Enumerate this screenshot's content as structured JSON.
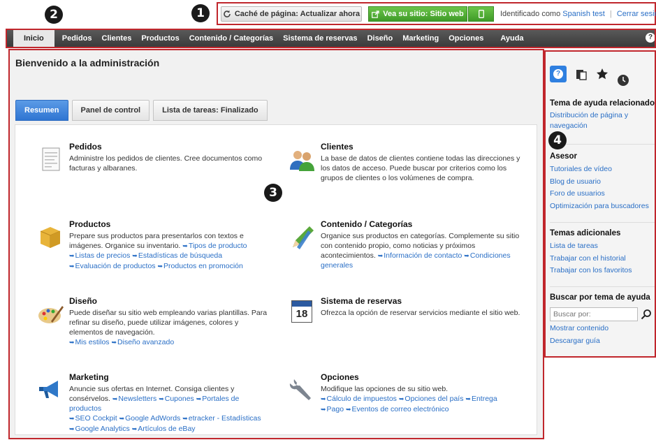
{
  "topbar": {
    "badge1": "1",
    "badge2": "2",
    "cache_button": "Caché de página: Actualizar ahora",
    "view_site_button": "Vea su sitio: Sitio web",
    "identified_label": "Identificado como",
    "user_name": "Spanish test",
    "logout": "Cerrar sesión"
  },
  "nav": {
    "items": [
      "Inicio",
      "Pedidos",
      "Clientes",
      "Productos",
      "Contenido / Categorías",
      "Sistema de reservas",
      "Diseño",
      "Marketing",
      "Opciones",
      "Ayuda"
    ],
    "help_glyph": "?"
  },
  "main": {
    "title": "Bienvenido a la administración",
    "badge3": "3",
    "tabs": [
      "Resumen",
      "Panel de control",
      "Lista de tareas: Finalizado"
    ],
    "cards": {
      "pedidos": {
        "title": "Pedidos",
        "desc": "Administre los pedidos de clientes. Cree documentos como facturas y albaranes."
      },
      "clientes": {
        "title": "Clientes",
        "desc": "La base de datos de clientes contiene todas las direcciones y los datos de acceso. Puede buscar por criterios como los grupos de clientes o los volúmenes de compra."
      },
      "productos": {
        "title": "Productos",
        "desc": "Prepare sus productos para presentarlos con textos e imágenes. Organice su inventario.",
        "links": [
          "Tipos de producto",
          "Listas de precios",
          "Estadísticas de búsqueda",
          "Evaluación de productos",
          "Productos en promoción"
        ]
      },
      "contenido": {
        "title": "Contenido / Categorías",
        "desc": "Organice sus productos en categorías. Complemente su sitio con contenido propio, como noticias y próximos acontecimientos.",
        "links": [
          "Información de contacto",
          "Condiciones generales"
        ]
      },
      "diseno": {
        "title": "Diseño",
        "desc": "Puede diseñar su sitio web empleando varias plantillas. Para refinar su diseño, puede utilizar imágenes, colores y elementos de navegación.",
        "links": [
          "Mis estilos",
          "Diseño avanzado"
        ]
      },
      "reservas": {
        "title": "Sistema de reservas",
        "desc": "Ofrezca la opción de reservar servicios mediante el sitio web.",
        "calendar_day": "18"
      },
      "marketing": {
        "title": "Marketing",
        "desc": "Anuncie sus ofertas en Internet. Consiga clientes y consérvelos.",
        "links": [
          "Newsletters",
          "Cupones",
          "Portales de productos",
          "SEO Cockpit",
          "Google AdWords",
          "etracker - Estadísticas",
          "Google Analytics",
          "Artículos de eBay"
        ]
      },
      "opciones": {
        "title": "Opciones",
        "desc": "Modifique las opciones de su sitio web.",
        "links": [
          "Cálculo de impuestos",
          "Opciones del país",
          "Entrega",
          "Pago",
          "Eventos de correo electrónico"
        ]
      }
    }
  },
  "sidebar": {
    "badge4": "4",
    "help_glyph": "?",
    "related": {
      "heading": "Tema de ayuda relacionado",
      "links": [
        "Distribución de página y navegación"
      ]
    },
    "advisor": {
      "heading": "Asesor",
      "links": [
        "Tutoriales de vídeo",
        "Blog de usuario",
        "Foro de usuarios",
        "Optimización para buscadores"
      ]
    },
    "additional": {
      "heading": "Temas adicionales",
      "links": [
        "Lista de tareas",
        "Trabajar con el historial",
        "Trabajar con los favoritos"
      ]
    },
    "search": {
      "heading": "Buscar por tema de ayuda",
      "placeholder": "Buscar por:",
      "links": [
        "Mostrar contenido",
        "Descargar guía"
      ]
    }
  },
  "colors": {
    "accent_blue": "#2f75d2",
    "green": "#3f9b28",
    "highlight_red": "#c0262c",
    "nav_dark": "#3b3b3b"
  }
}
